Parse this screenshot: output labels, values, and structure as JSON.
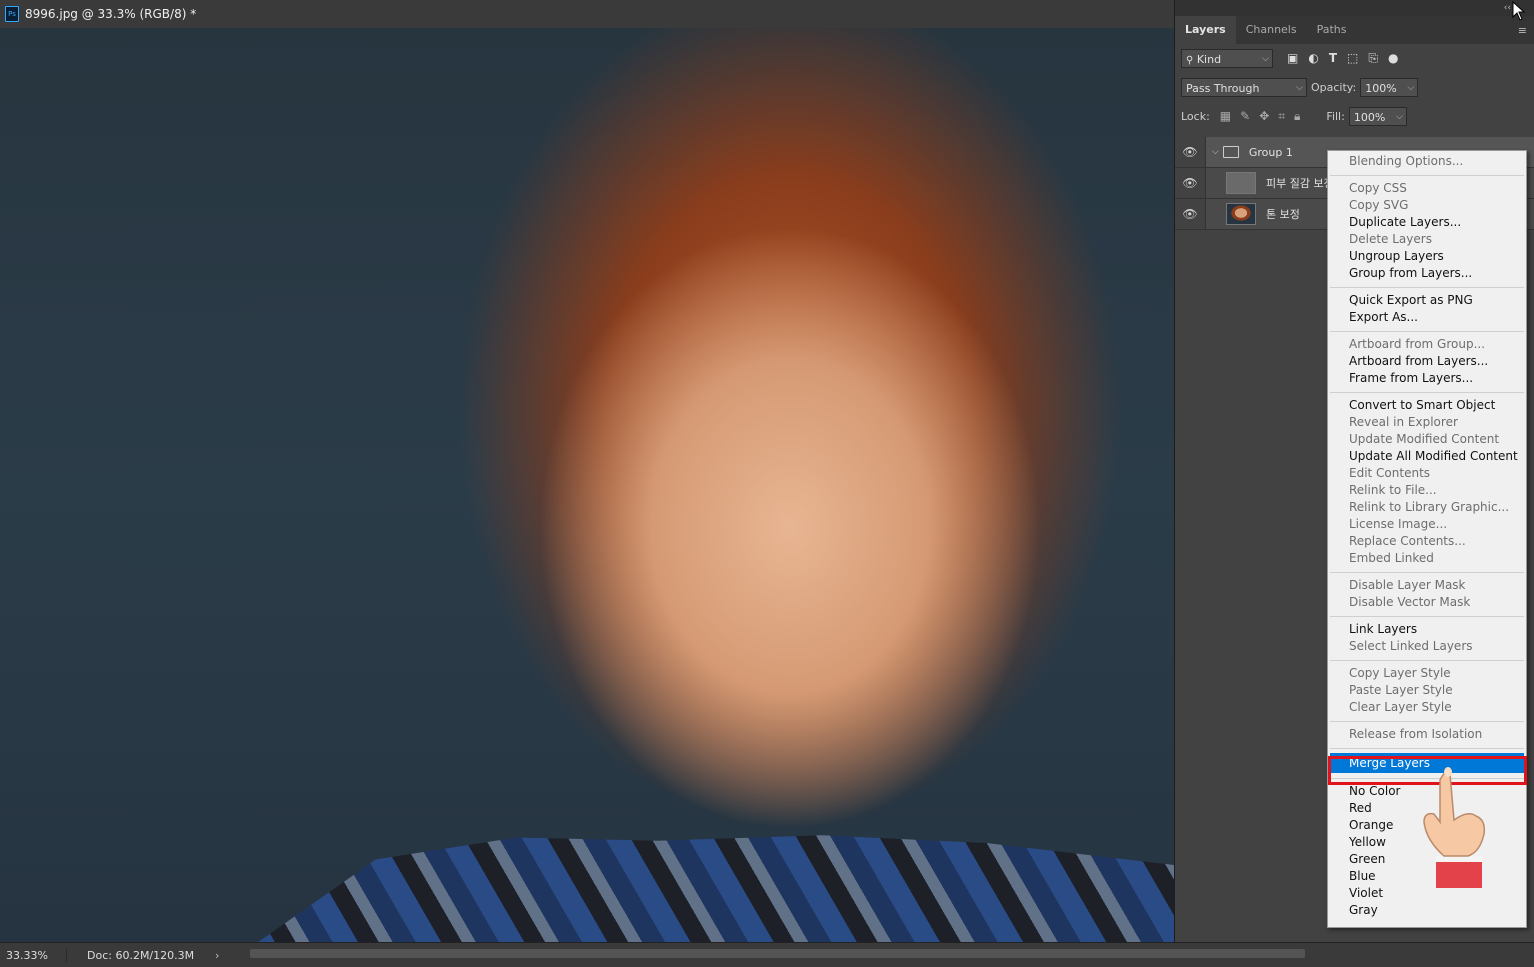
{
  "document": {
    "title": "8996.jpg @ 33.3% (RGB/8) *",
    "zoom": "33.33%",
    "doc_size": "Doc: 60.2M/120.3M"
  },
  "panel": {
    "collapse_glyph": "‹‹",
    "menu_icon": "hamburger-icon",
    "tabs": [
      {
        "label": "Layers",
        "active": true
      },
      {
        "label": "Channels",
        "active": false
      },
      {
        "label": "Paths",
        "active": false
      }
    ],
    "filter": {
      "value": "Kind"
    },
    "blend_mode": "Pass Through",
    "opacity_label": "Opacity:",
    "opacity": "100%",
    "lock_label": "Lock:",
    "fill_label": "Fill:",
    "fill": "100%"
  },
  "layers": [
    {
      "name": "Group 1",
      "type": "group"
    },
    {
      "name": "피부 질감 보정",
      "type": "layer",
      "thumb": "gray"
    },
    {
      "name": "톤 보정",
      "type": "layer",
      "thumb": "photo"
    }
  ],
  "context_menu": {
    "selected": "Merge Layers",
    "groups": [
      [
        {
          "label": "Blending Options...",
          "enabled": false
        }
      ],
      [
        {
          "label": "Copy CSS",
          "enabled": false
        },
        {
          "label": "Copy SVG",
          "enabled": false
        },
        {
          "label": "Duplicate Layers...",
          "enabled": true
        },
        {
          "label": "Delete Layers",
          "enabled": false
        },
        {
          "label": "Ungroup Layers",
          "enabled": true
        },
        {
          "label": "Group from Layers...",
          "enabled": true
        }
      ],
      [
        {
          "label": "Quick Export as PNG",
          "enabled": true
        },
        {
          "label": "Export As...",
          "enabled": true
        }
      ],
      [
        {
          "label": "Artboard from Group...",
          "enabled": false
        },
        {
          "label": "Artboard from Layers...",
          "enabled": true
        },
        {
          "label": "Frame from Layers...",
          "enabled": true
        }
      ],
      [
        {
          "label": "Convert to Smart Object",
          "enabled": true
        },
        {
          "label": "Reveal in Explorer",
          "enabled": false
        },
        {
          "label": "Update Modified Content",
          "enabled": false
        },
        {
          "label": "Update All Modified Content",
          "enabled": true
        },
        {
          "label": "Edit Contents",
          "enabled": false
        },
        {
          "label": "Relink to File...",
          "enabled": false
        },
        {
          "label": "Relink to Library Graphic...",
          "enabled": false
        },
        {
          "label": "License Image...",
          "enabled": false
        },
        {
          "label": "Replace Contents...",
          "enabled": false
        },
        {
          "label": "Embed Linked",
          "enabled": false
        }
      ],
      [
        {
          "label": "Disable Layer Mask",
          "enabled": false
        },
        {
          "label": "Disable Vector Mask",
          "enabled": false
        }
      ],
      [
        {
          "label": "Link Layers",
          "enabled": true
        },
        {
          "label": "Select Linked Layers",
          "enabled": false
        }
      ],
      [
        {
          "label": "Copy Layer Style",
          "enabled": false
        },
        {
          "label": "Paste Layer Style",
          "enabled": false
        },
        {
          "label": "Clear Layer Style",
          "enabled": false
        }
      ],
      [
        {
          "label": "Release from Isolation",
          "enabled": false
        }
      ],
      [
        {
          "label": "Merge Layers",
          "enabled": true
        }
      ],
      [
        {
          "label": "No Color",
          "enabled": true
        },
        {
          "label": "Red",
          "enabled": true
        },
        {
          "label": "Orange",
          "enabled": true
        },
        {
          "label": "Yellow",
          "enabled": true
        },
        {
          "label": "Green",
          "enabled": true
        },
        {
          "label": "Blue",
          "enabled": true
        },
        {
          "label": "Violet",
          "enabled": true
        },
        {
          "label": "Gray",
          "enabled": true
        }
      ]
    ]
  },
  "colors": {
    "accent": "#0078d7",
    "highlight": "#e0121b"
  }
}
